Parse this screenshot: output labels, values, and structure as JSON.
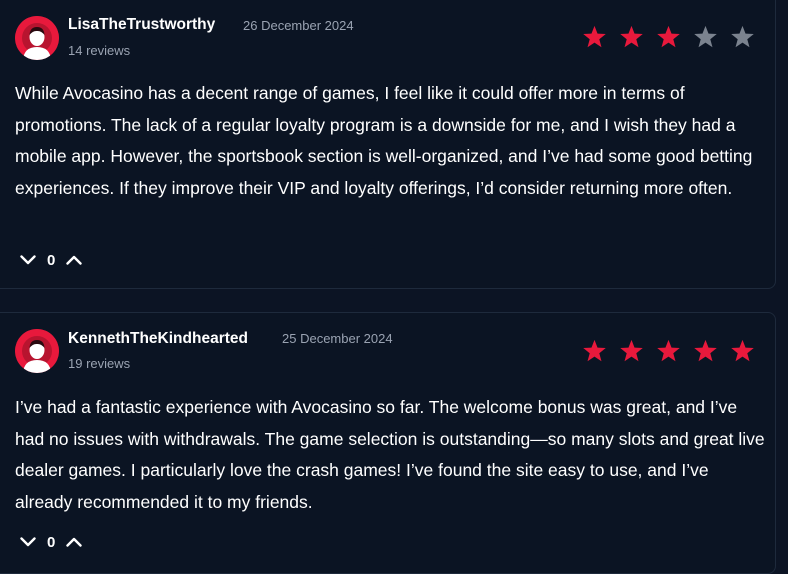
{
  "colors": {
    "background": "#0c1424",
    "accent": "#e8193c",
    "star_filled": "#e8193c",
    "star_empty": "#7b838f",
    "muted_text": "#9aa3b2"
  },
  "reviews": [
    {
      "username": "LisaTheTrustworthy",
      "date": "26 December 2024",
      "review_count": "14 reviews",
      "rating": 3,
      "max_rating": 5,
      "text": "While Avocasino has a decent range of games, I feel like it could offer more in terms of promotions. The lack of a regular loyalty program is a downside for me, and I wish they had a mobile app. However, the sportsbook section is well-organized, and I’ve had some good betting experiences. If they improve their VIP and loyalty offerings, I’d consider returning more often.",
      "votes": "0",
      "downvote_icon": "chevron-down-icon",
      "upvote_icon": "chevron-up-icon"
    },
    {
      "username": "KennethTheKindhearted",
      "date": "25 December 2024",
      "review_count": "19 reviews",
      "rating": 5,
      "max_rating": 5,
      "text": "I’ve had a fantastic experience with Avocasino so far. The welcome bonus was great, and I’ve had no issues with withdrawals. The game selection is outstanding—so many slots and great live dealer games. I particularly love the crash games! I’ve found the site easy to use, and I’ve already recommended it to my friends.",
      "votes": "0",
      "downvote_icon": "chevron-down-icon",
      "upvote_icon": "chevron-up-icon"
    }
  ]
}
